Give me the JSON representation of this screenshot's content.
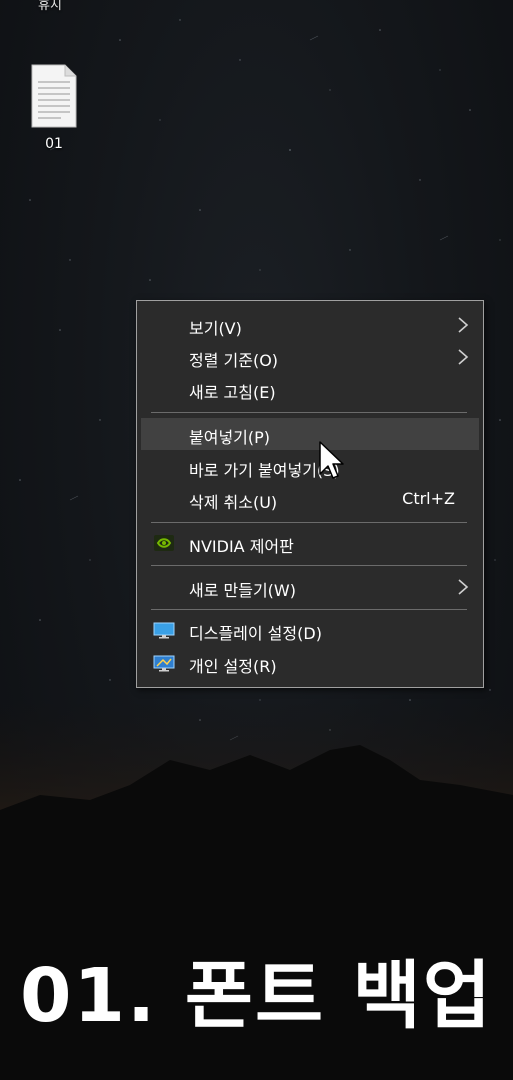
{
  "desktop": {
    "top_label": "휴지",
    "file_icon": {
      "label": "01",
      "icon": "text-file-icon"
    }
  },
  "context_menu": {
    "items": [
      {
        "label": "보기(V)",
        "submenu": true
      },
      {
        "label": "정렬 기준(O)",
        "submenu": true
      },
      {
        "label": "새로 고침(E)"
      },
      {
        "label": "붙여넣기(P)",
        "highlighted": true
      },
      {
        "label": "바로 가기 붙여넣기(S)"
      },
      {
        "label": "삭제 취소(U)",
        "shortcut": "Ctrl+Z"
      },
      {
        "label": "NVIDIA 제어판",
        "icon": "nvidia-icon"
      },
      {
        "label": "새로 만들기(W)",
        "submenu": true
      },
      {
        "label": "디스플레이 설정(D)",
        "icon": "display-icon"
      },
      {
        "label": "개인 설정(R)",
        "icon": "personalize-icon"
      }
    ]
  },
  "caption": "01. 폰트 백업",
  "colors": {
    "menu_bg": "#2b2b2b",
    "menu_highlight": "#414141",
    "menu_border": "#a0a0a0",
    "nvidia_green": "#76b900"
  }
}
